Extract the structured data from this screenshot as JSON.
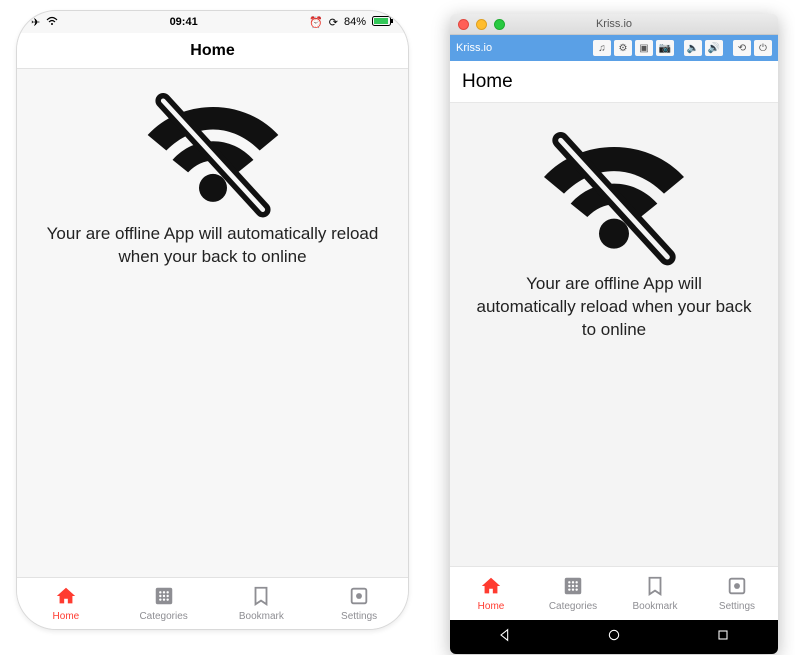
{
  "ios": {
    "status": {
      "time": "09:41",
      "battery": "84%"
    },
    "title": "Home",
    "offline_message": "Your are offline App will automatically reload when your back to online",
    "tabs": [
      {
        "label": "Home"
      },
      {
        "label": "Categories"
      },
      {
        "label": "Bookmark"
      },
      {
        "label": "Settings"
      }
    ]
  },
  "mac": {
    "window_title": "Kriss.io",
    "emulator_label": "Kriss.io",
    "app_title": "Home",
    "offline_message": "Your are offline App will automatically reload when your back to online",
    "tabs": [
      {
        "label": "Home"
      },
      {
        "label": "Categories"
      },
      {
        "label": "Bookmark"
      },
      {
        "label": "Settings"
      }
    ]
  },
  "colors": {
    "accent_active": "#ff3b30",
    "tab_inactive": "#8e8e93",
    "emulator_toolbar": "#5aa0e6"
  }
}
